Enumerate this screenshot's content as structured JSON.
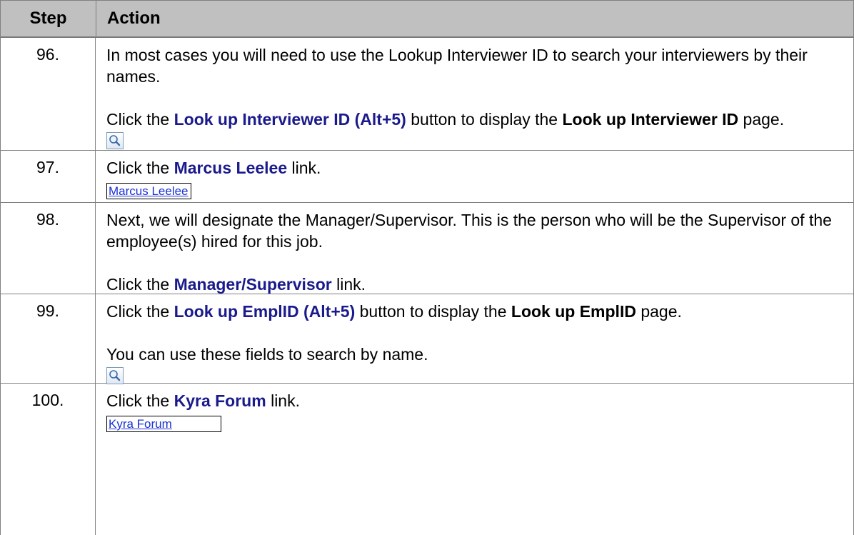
{
  "table": {
    "header": {
      "step": "Step",
      "action": "Action"
    },
    "rows": [
      {
        "step": "96.",
        "p1": "In most cases you will need to use the Lookup Interviewer ID to search your interviewers by their names.",
        "p2_pre": "Click the ",
        "p2_kw": "Look up Interviewer ID (Alt+5)",
        "p2_mid": " button to display the ",
        "p2_bold": "Look up Interviewer ID",
        "p2_post": " page.",
        "icon": "magnifier-lookup-icon"
      },
      {
        "step": "97.",
        "p1_pre": "Click the ",
        "p1_kw": "Marcus Leelee",
        "p1_post": " link.",
        "link": "Marcus Leelee"
      },
      {
        "step": "98.",
        "p1": "Next, we will designate the Manager/Supervisor.  This is the person who will be the Supervisor of the employee(s) hired for this job.",
        "p2_pre": "Click the ",
        "p2_kw": "Manager/Supervisor",
        "p2_post": " link."
      },
      {
        "step": "99.",
        "p1_pre": "Click the ",
        "p1_kw": "Look up EmplID (Alt+5)",
        "p1_mid": " button to display the ",
        "p1_bold": "Look up EmplID",
        "p1_post": " page.",
        "p2": "You can use these fields to search by name.",
        "icon": "magnifier-lookup-icon"
      },
      {
        "step": "100.",
        "p1_pre": "Click the ",
        "p1_kw": "Kyra Forum",
        "p1_post": " link.",
        "link": "Kyra Forum"
      }
    ]
  },
  "colors": {
    "header_bg": "#c0c0c0",
    "keyword": "#1a1a8c",
    "link": "#1b31d6",
    "border": "#808080"
  }
}
